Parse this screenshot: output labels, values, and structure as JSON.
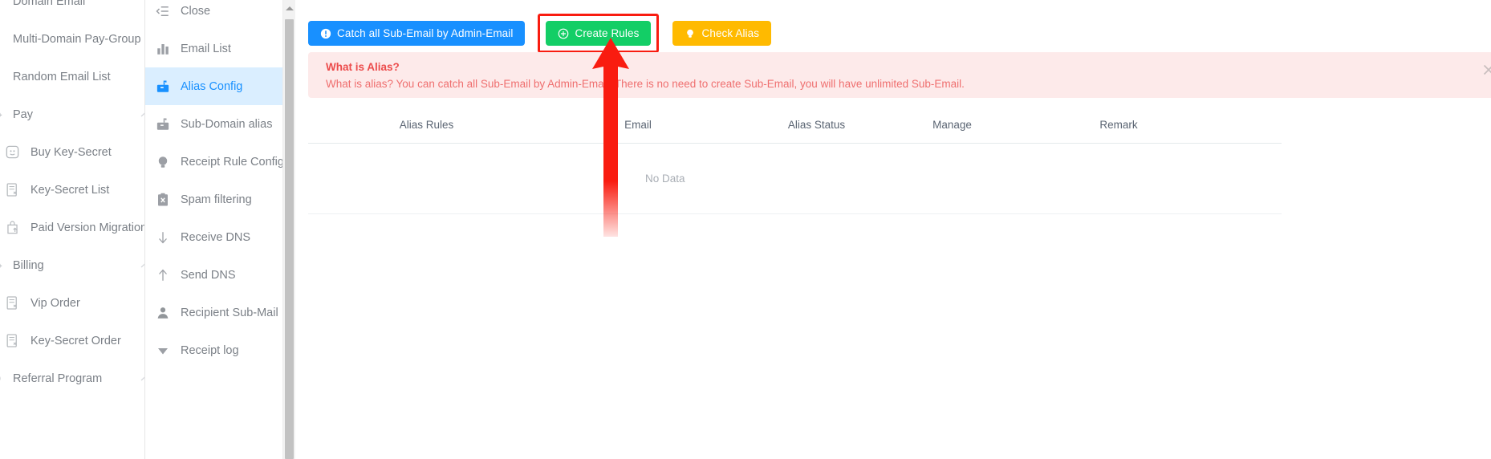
{
  "primary_nav": {
    "items": [
      {
        "label": "Domain Email",
        "icon": "domain-email-icon",
        "level": "top",
        "expandable": false
      },
      {
        "label": "Multi-Domain Pay-Group",
        "icon": "domain-email-icon",
        "level": "top",
        "expandable": false
      },
      {
        "label": "Random Email List",
        "icon": "domain-email-icon",
        "level": "top",
        "expandable": false
      },
      {
        "label": "Pay",
        "icon": "pay-icon",
        "level": "top",
        "expandable": true
      },
      {
        "label": "Buy Key-Secret",
        "icon": "buy-key-secret-icon",
        "level": "child",
        "expandable": false
      },
      {
        "label": "Key-Secret List",
        "icon": "document-list-icon",
        "level": "child",
        "expandable": false
      },
      {
        "label": "Paid Version Migration",
        "icon": "upgrade-bag-icon",
        "level": "child",
        "expandable": false
      },
      {
        "label": "Billing",
        "icon": "pay-icon",
        "level": "top",
        "expandable": true
      },
      {
        "label": "Vip Order",
        "icon": "document-list-icon",
        "level": "child",
        "expandable": false
      },
      {
        "label": "Key-Secret Order",
        "icon": "document-list-icon",
        "level": "child",
        "expandable": false
      },
      {
        "label": "Referral Program",
        "icon": "referral-icon",
        "level": "top",
        "expandable": true
      }
    ]
  },
  "sub_nav": {
    "items": [
      {
        "label": "Close",
        "icon": "collapse-menu-icon",
        "active": false
      },
      {
        "label": "Email List",
        "icon": "bar-chart-icon",
        "active": false
      },
      {
        "label": "Alias Config",
        "icon": "mailbox-icon",
        "active": true
      },
      {
        "label": "Sub-Domain alias",
        "icon": "mailbox-icon",
        "active": false
      },
      {
        "label": "Receipt Rule Config",
        "icon": "bulb-icon",
        "active": false
      },
      {
        "label": "Spam filtering",
        "icon": "spam-clipboard-icon",
        "active": false
      },
      {
        "label": "Receive DNS",
        "icon": "arrow-down-icon",
        "active": false
      },
      {
        "label": "Send DNS",
        "icon": "arrow-up-icon",
        "active": false
      },
      {
        "label": "Recipient Sub-Mail",
        "icon": "user-icon",
        "active": false
      },
      {
        "label": "Receipt log",
        "icon": "caret-down-icon",
        "active": false
      }
    ]
  },
  "toolbar": {
    "catch_all_label": "Catch all Sub-Email by Admin-Email",
    "catch_all_icon": "info-circle-icon",
    "catch_all_color": "#1890ff",
    "create_rules_label": "Create Rules",
    "create_rules_icon": "plus-circle-icon",
    "create_rules_color": "#13ce66",
    "check_alias_label": "Check Alias",
    "check_alias_icon": "bulb-icon",
    "check_alias_color": "#ffba00"
  },
  "alert": {
    "title": "What is Alias?",
    "body": "What is alias? You can catch all Sub-Email by Admin-Email. There is no need to create Sub-Email, you will have unlimited Sub-Email.",
    "close_icon": "close-icon",
    "background": "#fdeaea",
    "title_color": "#ec4b4b",
    "text_color": "#ef6f6f"
  },
  "table": {
    "headers": [
      "Alias Rules",
      "Email",
      "Alias Status",
      "Manage",
      "Remark"
    ],
    "rows": [],
    "empty_text": "No Data"
  },
  "annotation": {
    "highlight_color": "#f91c10",
    "arrow_color": "#f91c10",
    "target": "Create Rules"
  }
}
